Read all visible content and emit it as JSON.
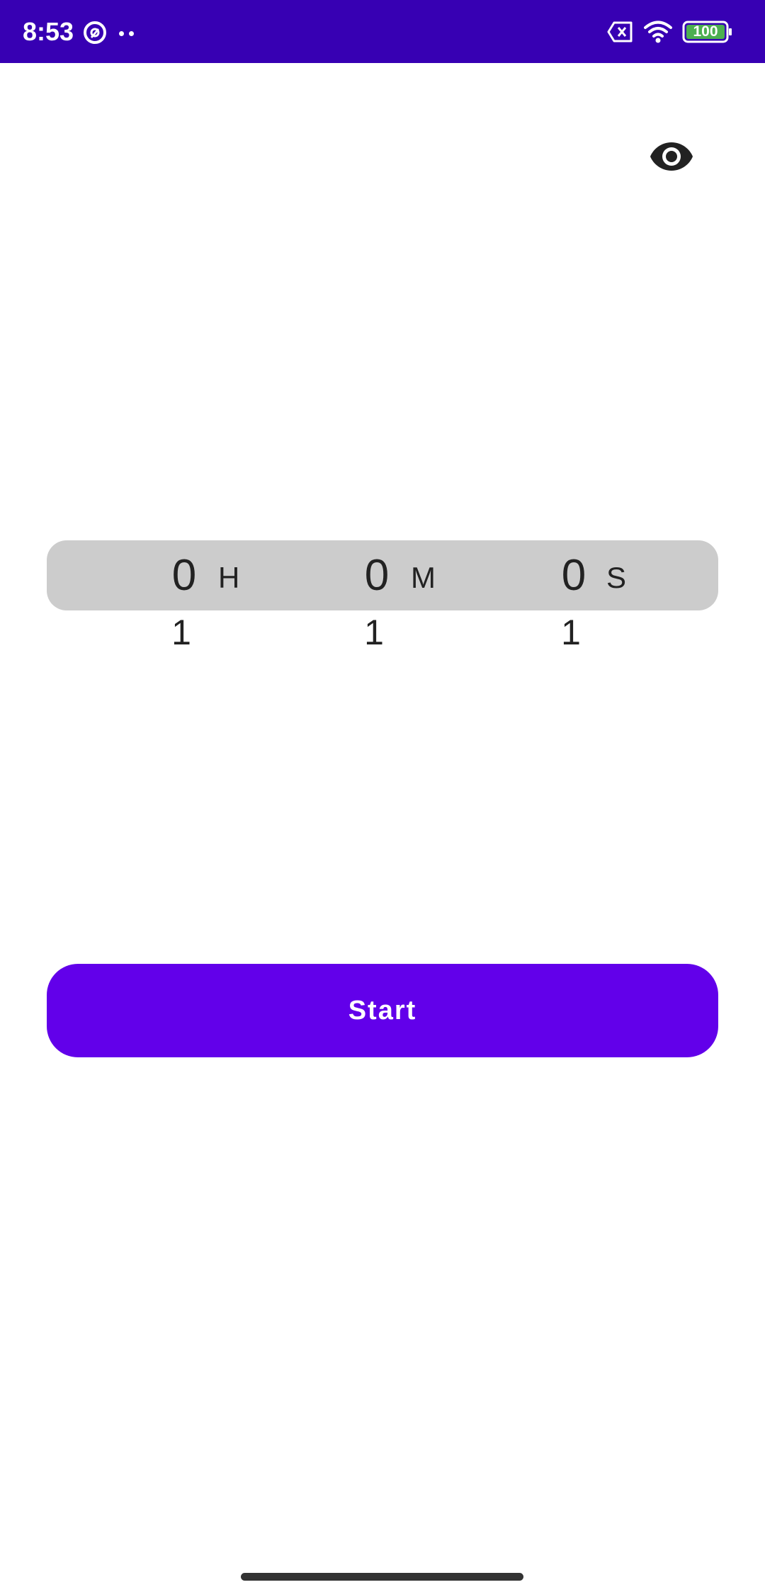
{
  "status_bar": {
    "time": "8:53",
    "battery_level": "100",
    "background_color": "#3700b3",
    "icons": [
      "navigation-icon",
      "more-dots-icon",
      "no-sim-icon",
      "wifi-icon",
      "battery-icon"
    ]
  },
  "toolbar": {
    "visibility_icon": "eye-icon"
  },
  "timer_picker": {
    "hours": {
      "value": "0",
      "unit": "H",
      "next": "1"
    },
    "minutes": {
      "value": "0",
      "unit": "M",
      "next": "1"
    },
    "seconds": {
      "value": "0",
      "unit": "S",
      "next": "1"
    }
  },
  "actions": {
    "start_label": "Start",
    "accent_color": "#6200ea"
  }
}
